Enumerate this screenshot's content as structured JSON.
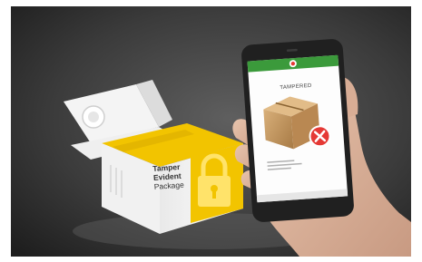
{
  "package": {
    "label_lines": [
      "Tamper",
      "Evident",
      "Package"
    ],
    "accent_color": "#f2c400",
    "icon": "padlock-icon"
  },
  "phone": {
    "status_color": "#3b9a3b",
    "app_icon": "shield-icon",
    "screen_title": "TAMPERED",
    "status_icon": "error-x-icon",
    "status_color_alert": "#e53935",
    "note_lines": [
      "",
      "",
      ""
    ]
  }
}
